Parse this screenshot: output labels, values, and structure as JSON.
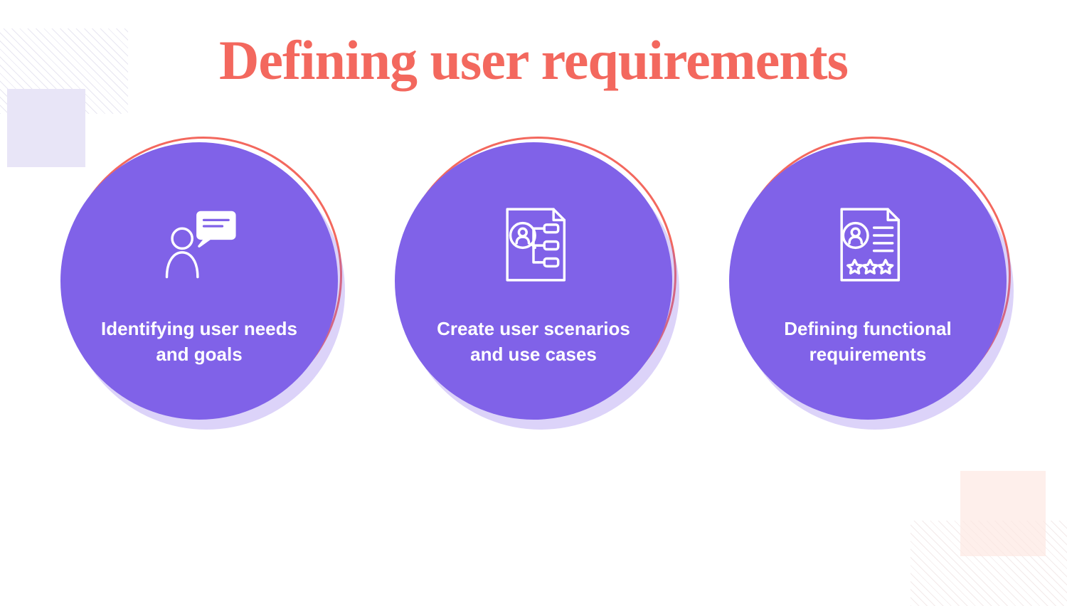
{
  "title": "Defining user requirements",
  "items": [
    {
      "caption": "Identifying user needs and goals",
      "icon": "user-speech-icon"
    },
    {
      "caption": "Create user scenarios and use cases",
      "icon": "document-flow-icon"
    },
    {
      "caption": "Defining functional requirements",
      "icon": "document-profile-icon"
    }
  ],
  "colors": {
    "accent": "#f3685e",
    "disc": "#8062e8",
    "text_on_disc": "#ffffff"
  }
}
